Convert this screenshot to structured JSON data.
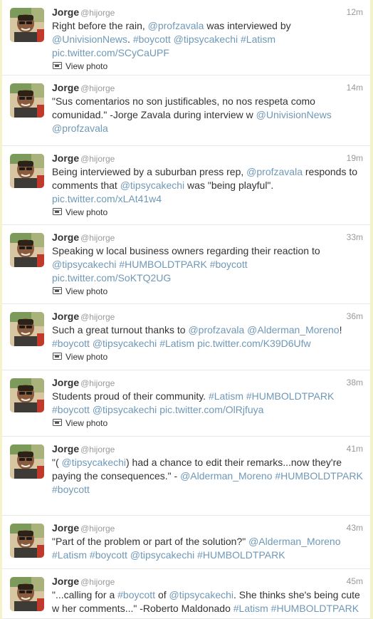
{
  "tweets": [
    {
      "name": "Jorge",
      "handle": "@hijorge",
      "time": "12m",
      "segments": [
        {
          "t": "Right before the rain, "
        },
        {
          "t": "@profzavala",
          "link": true
        },
        {
          "t": " was interviewed by "
        },
        {
          "t": "@UnivisionNews",
          "link": true
        },
        {
          "t": ". "
        },
        {
          "t": "#boycott",
          "link": true
        },
        {
          "t": " "
        },
        {
          "t": "@tipsycakechi",
          "link": true
        },
        {
          "t": " "
        },
        {
          "t": "#Latism",
          "link": true
        },
        {
          "t": " "
        },
        {
          "t": "pic.twitter.com/SCyCaUPF",
          "link": true
        }
      ],
      "photo": "View photo"
    },
    {
      "name": "Jorge",
      "handle": "@hijorge",
      "time": "14m",
      "segments": [
        {
          "t": "\"Sus comentarios no son justificables, no nos respeta como comunidad.\" -Jorge Zavala during interview w "
        },
        {
          "t": "@UnivisionNews",
          "link": true
        },
        {
          "t": " "
        },
        {
          "t": "@profzavala",
          "link": true
        }
      ],
      "photo": null
    },
    {
      "name": "Jorge",
      "handle": "@hijorge",
      "time": "19m",
      "segments": [
        {
          "t": "Being interviewed by a suburban press rep, "
        },
        {
          "t": "@profzavala",
          "link": true
        },
        {
          "t": " responds to comments that "
        },
        {
          "t": "@tipsycakechi",
          "link": true
        },
        {
          "t": " was \"being playful\". "
        },
        {
          "t": "pic.twitter.com/xLAt41w4",
          "link": true
        }
      ],
      "photo": "View photo"
    },
    {
      "name": "Jorge",
      "handle": "@hijorge",
      "time": "33m",
      "segments": [
        {
          "t": "Speaking w local business owners regarding their reaction to "
        },
        {
          "t": "@tipsycakechi",
          "link": true
        },
        {
          "t": " "
        },
        {
          "t": "#HUMBOLDTPARK",
          "link": true
        },
        {
          "t": " "
        },
        {
          "t": "#boycott",
          "link": true
        },
        {
          "t": " "
        },
        {
          "t": "pic.twitter.com/SoKTQ2UG",
          "link": true
        }
      ],
      "photo": "View photo"
    },
    {
      "name": "Jorge",
      "handle": "@hijorge",
      "time": "36m",
      "segments": [
        {
          "t": "Such a great turnout thanks to "
        },
        {
          "t": "@profzavala",
          "link": true
        },
        {
          "t": " "
        },
        {
          "t": "@Alderman_Moreno",
          "link": true
        },
        {
          "t": "! "
        },
        {
          "t": "#boycott",
          "link": true
        },
        {
          "t": " "
        },
        {
          "t": "@tipsycakechi",
          "link": true
        },
        {
          "t": " "
        },
        {
          "t": "#Latism",
          "link": true
        },
        {
          "t": " "
        },
        {
          "t": "pic.twitter.com/K39D6Ufw",
          "link": true
        }
      ],
      "photo": "View photo"
    },
    {
      "name": "Jorge",
      "handle": "@hijorge",
      "time": "38m",
      "segments": [
        {
          "t": "Students proud of their community. "
        },
        {
          "t": "#Latism",
          "link": true
        },
        {
          "t": " "
        },
        {
          "t": "#HUMBOLDTPARK",
          "link": true
        },
        {
          "t": " "
        },
        {
          "t": "#boycott",
          "link": true
        },
        {
          "t": " "
        },
        {
          "t": "@tipsycakechi",
          "link": true
        },
        {
          "t": " "
        },
        {
          "t": "pic.twitter.com/OlRjfuya",
          "link": true
        }
      ],
      "photo": "View photo"
    },
    {
      "name": "Jorge",
      "handle": "@hijorge",
      "time": "41m",
      "segments": [
        {
          "t": "\"( "
        },
        {
          "t": "@tipsycakechi",
          "link": true
        },
        {
          "t": ") had a chance to edit their remarks...now they're paying the consequences.\" - "
        },
        {
          "t": "@Alderman_Moreno",
          "link": true
        },
        {
          "t": " "
        },
        {
          "t": "#HUMBOLDTPARK",
          "link": true
        },
        {
          "t": " "
        },
        {
          "t": "#boycott",
          "link": true
        }
      ],
      "photo": null
    },
    {
      "name": "Jorge",
      "handle": "@hijorge",
      "time": "43m",
      "segments": [
        {
          "t": "\"Part of the problem or part of the solution?\" "
        },
        {
          "t": "@Alderman_Moreno",
          "link": true
        },
        {
          "t": " "
        },
        {
          "t": "#Latism",
          "link": true
        },
        {
          "t": " "
        },
        {
          "t": "#boycott",
          "link": true
        },
        {
          "t": " "
        },
        {
          "t": "@tipsycakechi",
          "link": true
        },
        {
          "t": " "
        },
        {
          "t": "#HUMBOLDTPARK",
          "link": true
        }
      ],
      "photo": null
    },
    {
      "name": "Jorge",
      "handle": "@hijorge",
      "time": "45m",
      "segments": [
        {
          "t": "\"...calling for a "
        },
        {
          "t": "#boycott",
          "link": true
        },
        {
          "t": " of "
        },
        {
          "t": "@tipsycakechi",
          "link": true
        },
        {
          "t": ". She thinks she's being cute w her comments...\" -Roberto Maldonado "
        },
        {
          "t": "#Latism",
          "link": true
        },
        {
          "t": " "
        },
        {
          "t": "#HUMBOLDTPARK",
          "link": true
        }
      ],
      "photo": null
    }
  ]
}
